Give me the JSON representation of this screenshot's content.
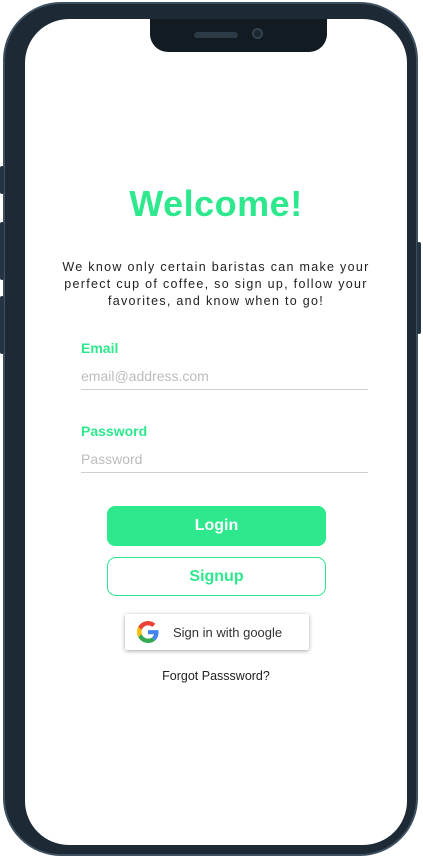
{
  "header": {
    "title": "Welcome!",
    "subtitle": "We know only certain baristas can make your perfect cup of coffee, so sign up, follow your favorites, and know when to go!"
  },
  "form": {
    "email_label": "Email",
    "email_placeholder": "email@address.com",
    "password_label": "Password",
    "password_placeholder": "Password"
  },
  "actions": {
    "login_label": "Login",
    "signup_label": "Signup",
    "google_label": "Sign in with google",
    "forgot_label": "Forgot Passsword?"
  },
  "icons": {
    "google": "google-g-icon"
  },
  "colors": {
    "accent": "#2ee88d",
    "frame": "#1d2a36"
  }
}
